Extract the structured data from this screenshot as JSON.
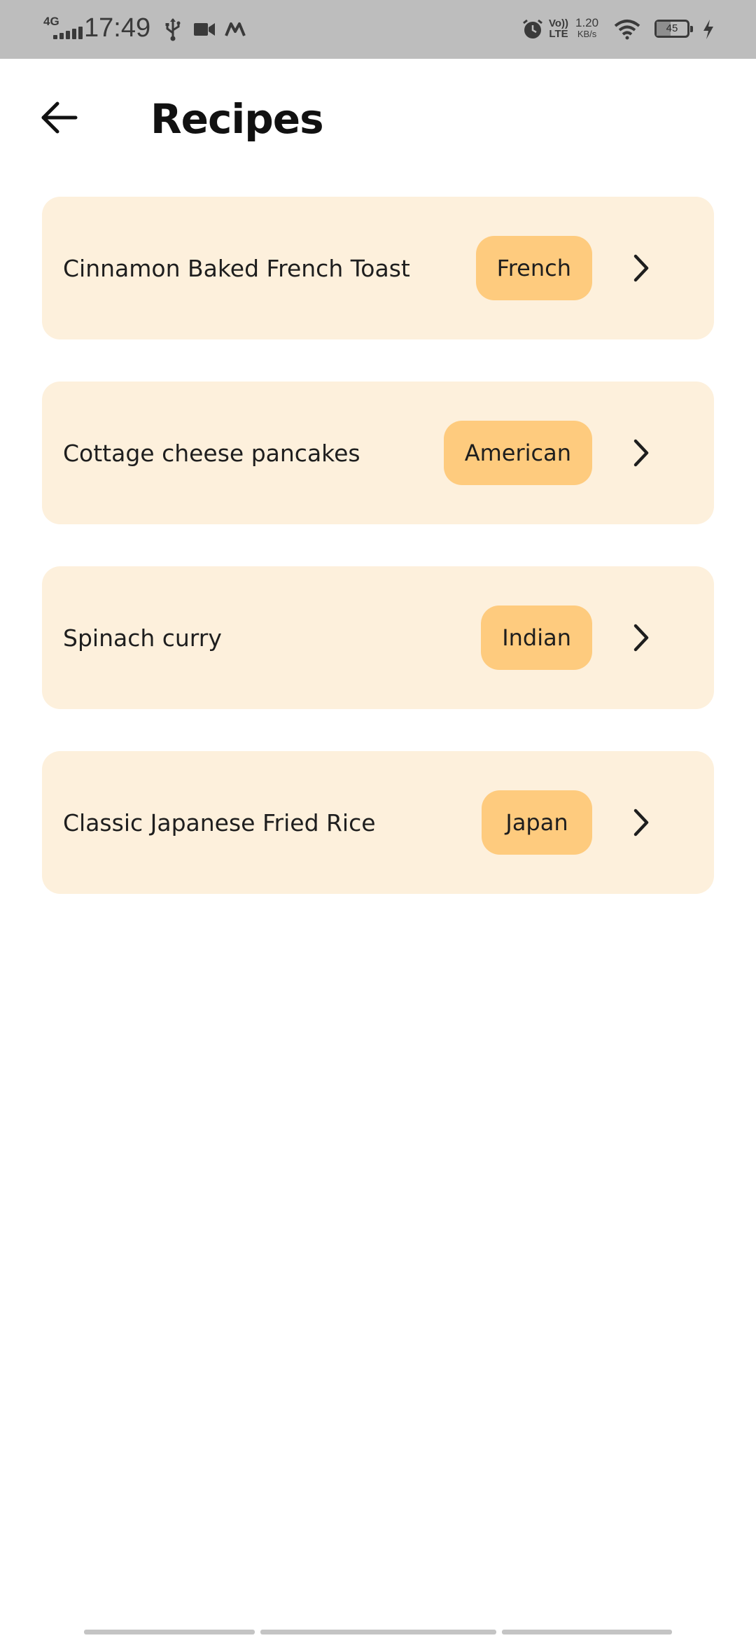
{
  "status_bar": {
    "network": "4G",
    "time": "17:49",
    "volte": "Vo)) LTE",
    "speed_value": "1.20",
    "speed_unit": "KB/s",
    "battery": "45",
    "battery_level": 0.45,
    "icons": [
      "signal-icon",
      "usb-icon",
      "video-camera-icon",
      "myntra-icon",
      "alarm-icon",
      "wifi-icon",
      "battery-icon",
      "charging-icon"
    ]
  },
  "header": {
    "back_icon": "arrow-left-icon",
    "title": "Recipes"
  },
  "recipes": [
    {
      "name": "Cinnamon Baked French Toast",
      "cuisine": "French"
    },
    {
      "name": "Cottage cheese pancakes",
      "cuisine": "American"
    },
    {
      "name": "Spinach curry",
      "cuisine": "Indian"
    },
    {
      "name": "Classic Japanese Fried Rice",
      "cuisine": "Japan"
    }
  ],
  "colors": {
    "status_bar": "#bdbdbd",
    "card_background": "#fdf0dc",
    "badge_background": "#fecb7e",
    "text": "#1e1e1e"
  }
}
